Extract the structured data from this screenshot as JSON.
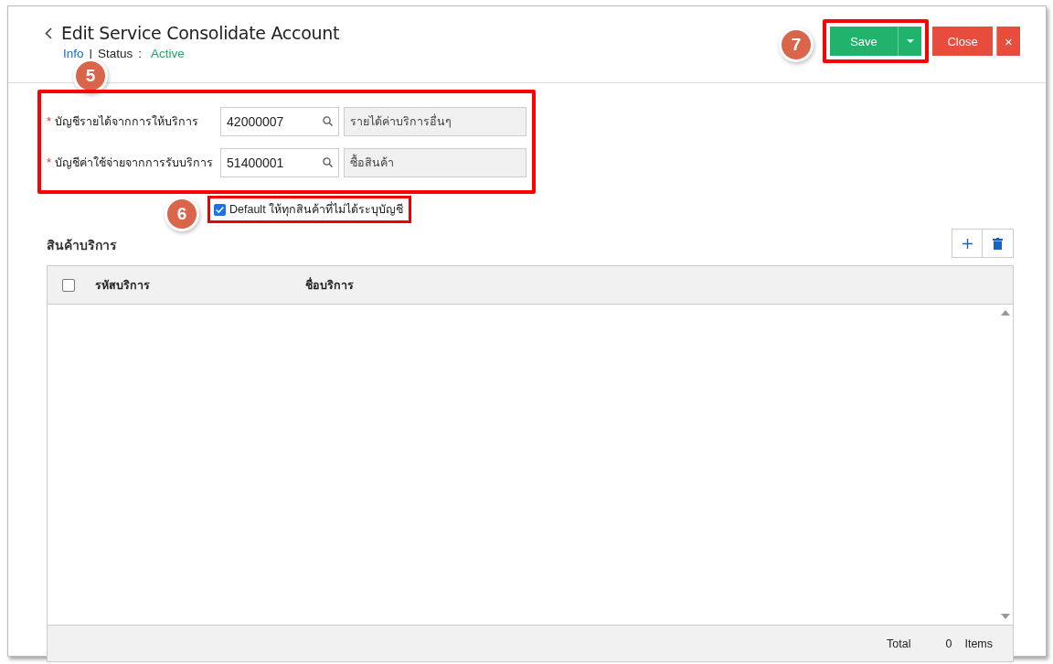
{
  "header": {
    "title": "Edit Service Consolidate Account",
    "info_link": "Info",
    "separator": "|",
    "status_label": "Status",
    "status_colon": ":",
    "status_value": "Active"
  },
  "actions": {
    "save": "Save",
    "close": "Close",
    "close_x": "×"
  },
  "form": [
    {
      "required_mark": "*",
      "label": "บัญชีรายได้จากการให้บริการ",
      "code": "42000007",
      "name": "รายได้ค่าบริการอื่นๆ"
    },
    {
      "required_mark": "*",
      "label": "บัญชีค่าใช้จ่ายจากการรับบริการ",
      "code": "51400001",
      "name": "ซื้อสินค้า"
    }
  ],
  "default_checkbox": {
    "label": "Default ให้ทุกสินค้าที่ไม่ได้ระบุบัญชี",
    "checked": true
  },
  "section": {
    "title": "สินค้าบริการ"
  },
  "table": {
    "select_all_checked": false,
    "columns": [
      "รหัสบริการ",
      "ชื่อบริการ"
    ]
  },
  "footer": {
    "total_label": "Total",
    "count": "0",
    "unit": "Items"
  },
  "callouts": [
    {
      "number": "5"
    },
    {
      "number": "6"
    },
    {
      "number": "7"
    }
  ]
}
